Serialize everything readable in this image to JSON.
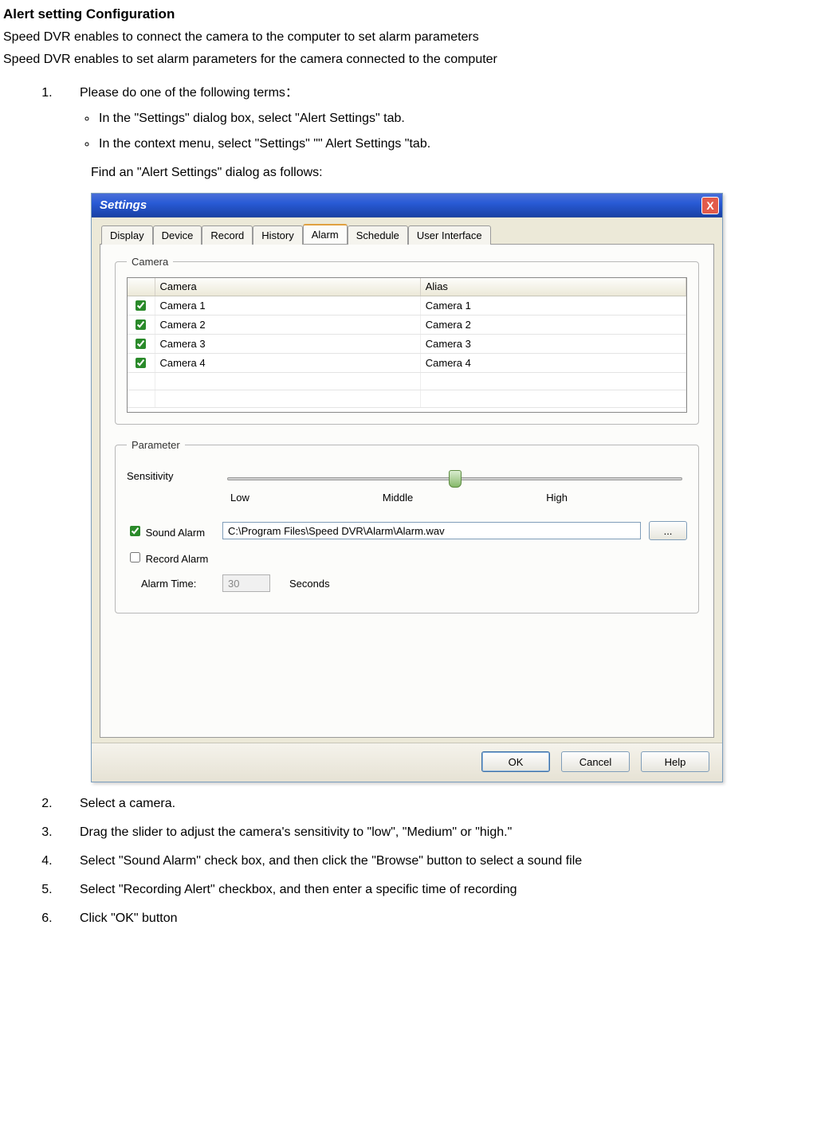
{
  "doc": {
    "title": "Alert setting Configuration",
    "line1": "Speed DVR enables to connect the camera to the computer to set alarm parameters",
    "line2": "Speed DVR enables to set alarm parameters for the camera connected to the computer",
    "step1": "Please do one of the following terms：",
    "step1a": "In the \"Settings\" dialog box, select \"Alert Settings\" tab.",
    "step1b": "In the context menu, select \"Settings\" \"\" Alert Settings \"tab.",
    "step1_find": "Find an \"Alert Settings\" dialog as follows:",
    "step2": "Select a camera.",
    "step3": "Drag the slider to adjust the camera's sensitivity to \"low\", \"Medium\" or \"high.\"",
    "step4": "Select \"Sound Alarm\" check box, and then click the \"Browse\" button to select a sound file",
    "step5": "Select \"Recording Alert\" checkbox, and then enter a specific time of recording",
    "step6": "Click \"OK\" button"
  },
  "dialog": {
    "title": "Settings",
    "close_x": "X",
    "tabs": {
      "display": "Display",
      "device": "Device",
      "record": "Record",
      "history": "History",
      "alarm": "Alarm",
      "schedule": "Schedule",
      "userinterface": "User Interface"
    },
    "camera_group": {
      "legend": "Camera",
      "col_camera": "Camera",
      "col_alias": "Alias",
      "rows": [
        {
          "camera": "Camera 1",
          "alias": "Camera 1"
        },
        {
          "camera": "Camera 2",
          "alias": "Camera 2"
        },
        {
          "camera": "Camera 3",
          "alias": "Camera 3"
        },
        {
          "camera": "Camera 4",
          "alias": "Camera 4"
        }
      ]
    },
    "param_group": {
      "legend": "Parameter",
      "sensitivity_label": "Sensitivity",
      "low": "Low",
      "middle": "Middle",
      "high": "High",
      "sound_alarm_label": "Sound Alarm",
      "sound_path": "C:\\Program Files\\Speed DVR\\Alarm\\Alarm.wav",
      "browse_label": "...",
      "record_alarm_label": "Record Alarm",
      "alarm_time_label": "Alarm Time:",
      "alarm_time_value": "30",
      "seconds_label": "Seconds"
    },
    "buttons": {
      "ok": "OK",
      "cancel": "Cancel",
      "help": "Help"
    }
  }
}
